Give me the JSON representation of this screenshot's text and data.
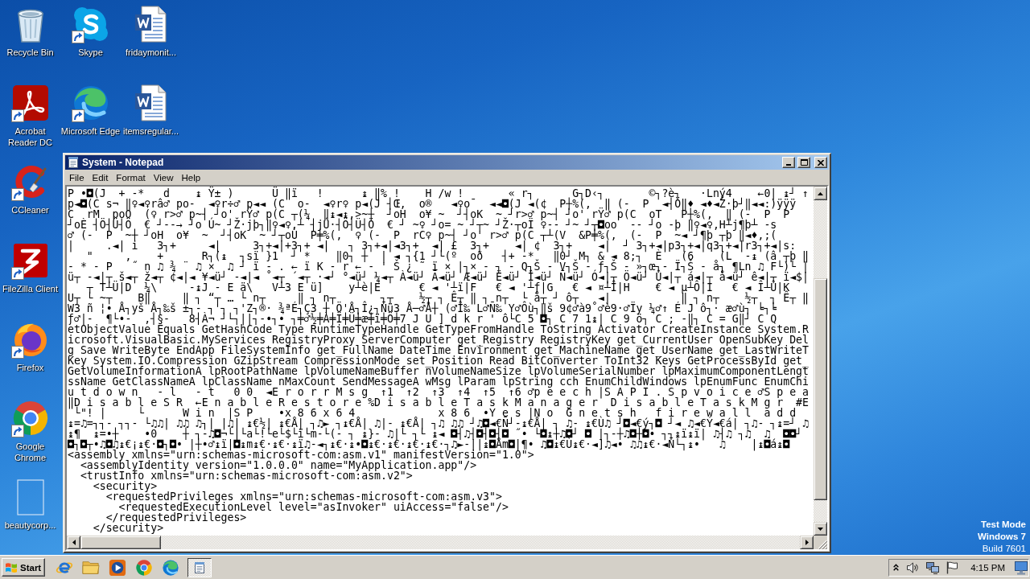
{
  "desktop": {
    "icon_columns": [
      [
        {
          "label": "Recycle Bin",
          "kind": "recyclebin",
          "shortcut": false
        },
        {
          "label": "Acrobat Reader DC",
          "kind": "acrobat",
          "shortcut": true
        },
        {
          "label": "CCleaner",
          "kind": "ccleaner",
          "shortcut": true
        },
        {
          "label": "FileZilla Client",
          "kind": "filezilla",
          "shortcut": true
        },
        {
          "label": "Firefox",
          "kind": "firefox",
          "shortcut": true
        },
        {
          "label": "Google Chrome",
          "kind": "chrome",
          "shortcut": true
        },
        {
          "label": "beautycorp...",
          "kind": "blank",
          "shortcut": false
        }
      ],
      [
        {
          "label": "Skype",
          "kind": "skype",
          "shortcut": true
        },
        {
          "label": "Microsoft Edge",
          "kind": "edge",
          "shortcut": true
        }
      ],
      [
        {
          "label": "fridaymonit...",
          "kind": "word",
          "shortcut": false
        },
        {
          "label": "itemsregular...",
          "kind": "word",
          "shortcut": false
        }
      ]
    ],
    "os_notice": {
      "mode": "Test Mode",
      "edition": "Windows 7",
      "build": "Build 7601"
    }
  },
  "notepad": {
    "title": "System - Notepad",
    "menu": [
      "File",
      "Edit",
      "Format",
      "View",
      "Help"
    ],
    "lines": [
      "P •◘(J  + -*   d    ↨ Ÿ± )      Ü ‖ï   !      ↨ ‖% !    H /w !       « r┐      G┐D‹┐       ©┐?è┐   ·Lný4    ←0| ↨┘ ↑",
      "p◄◘(C s¬ ‖♀◄♀râ♂ po-  ◄♀r÷♂ p◄◄ (C  o-  ◄♀r♀ p◄(J ┤Œ,  o®   ◄♀o¯  ◄◄◘(J ◄(¢  P┼%(,  ‖ (-  P  ◄┤Ö‖♦ ◄♦◄Ž·þ┘‖◄◄:)ÿÿÿ",
      "C  rM  poO  (♀ r>♂ p~┤ ┘o' rŸ♂ p(C ┬(¼  ‖↨◄↨,>~┼  ┘oH  o¥ ~  ┘┤oK  ~ ┘r>♂ p~┤ ┘o' rŸ♂ p(C  oT   P┼%(,  ‖ (-  P  P",
      "┘oÈ ┤Ö┤Ü┤Ö  € ┘--→ ┘o Ú~ ┘Ž·jþ┐‖♀◄♀,┴ ┤jÚ·┤Ö┤Ü┤Ö  € ┘ ~♀ ┘o= ~ ┘┬~ ┘Ž·┬oÏ ♀-- ┘~ ┘┬◘oo  -- ┘o -þ ‖♀◄♀,H┴j¶þ┴ -s",
      "♂ (-  P  ~┼ ┘oH  o¥  ~  ┘┤oK  ~ ┘┬oÙ  P╪%(,  ♀ (-  P  rC♀ p~┤ ┘o' r>♂ p(C ┬┴(V  &P╪%(,  (-  P  ~◄ ┘¶þ ┬þ ‖◄♦,;(",
      "|     .◄| i   3┐+     ◄|     3┐+◄|+3┐+ ◄|   ┐ 3┐+◄|◄3┐+  ◄| £  3┐+    ◄| ¢  3┐+    ◄|  ┘ 3┐+◄|p3┐+◄|q3┐+◄|r3┐+◄|s:",
      "   \"     ,    +      R┐(↨  ┐sï }1  ┘ *    ‖0┐ ┼  | ◄ ┐{1 ┘└(º  oð   ┤+ -*   ‖0┘ M┐ & ◄ 8;┐  È   (6    (L  -↨ (â ┬þ ‖",
      "- * - P   ˝ n ♫ ¾ ¨ ♫ ×  ♫ ┘ ï - . ← ï K - r ← - ' Š ¿ ˜ ï × |┐× - ┐ - Q┐Š - V┐Š - ƒ┐Š - »┐œ┐- Ï┐Š - å┐ ¶Ln ♫ F└)└ |",
      "ü┬ -◄|┬ š◄┬ ž◄┬ ¢◄|◄ ¥◄ü┘ -◄|◄ ˚◄┬ ´◄┬ ·◄┘ °◄ü┘ ¼◄┬ À◄ü┘ Ã◄ü┘ Æ◄ü┘ Ë◄ü┘ Î◄ü┘ Ñ◄ü┘ Ó◄|┬ Ö◄ü┘ Û◄|┬ á◄|┬ å◄ü┘ ê◄|┬ ï◄$|",
      "   ┬ T┴Ü|D  ¼\\     -↨J - E ä\\   V┴3 E ü]    y┴è|E      € ◄ '┴ï|F   € ◄ '┴ƒ|G   € ◄ ¤┴Î|H    € ◄ µ┴Ô|I   € ◄ Î┴Û|K",
      "U┬ └ ~┬    B‖     ‖ ┐ “┬ … └ n┬     ‖ ┐ n┬       ┐┬    ½┬ ┐ Ê┬ ‖ ┐ n┬  └ å┬ ┘ ô┬   ◄|           ‖ ┐ n┬    ½┬  ┐ Ê┬ ‖",
      "W3 ñ ¦• Å┐yš Å┐‰š ±┐- ┐'┐ ┐'Z┐®· ¾ªÉ┐Ç3 ┼ Ö'Å┐Î¿┐Ñü3 Å─♂Å┼ (♂Î‰ L♂Ñ‰ Y♂Ôù┐‖š 9¢♂à9˚♂è9·♂Ïy ¼♂↑ É J ô┐· æ♂ù┐ ╘┐╘",
      "ƒ♂|-  ¶└•-  ,┤§-   8┤À¬ ┘└┐||┐-•┐• ┐╪♂½╪À╪Ï╪Ü╪æ╪ï╪Ö╪7 J U ] d k r ' ô└C 5 ◘┐ C 7 1↨| C 9 ö┐ C ; -‖┐ C = G‖┘ C Q",
      "etObjectValue Equals GetHashCode Type RuntimeTypeHandle GetTypeFromHandle ToString Activator CreateInstance System.R",
      "icrosoft.VisualBasic.MyServices RegistryProxy ServerComputer get_Registry RegistryKey get_CurrentUser OpenSubKey Del",
      "g Save WriteByte EndApp FileSystemInfo get_FullName DateTime Environment get_MachineName get_UserName get_LastWriteT",
      "Key System.IO.Compression GZipStream CompressionMode set_Position Read BitConverter ToInt32 Keys GetProcessById get_",
      "GetVolumeInformationA lpRootPathName lpVolumeNameBuffer nVolumeNameSize lpVolumeSerialNumber lpMaximumComponentLengt",
      "ssName GetClassNameA lpClassName nMaxCount SendMessageA wMsg lParam lpString cch EnumChildWindows lpEnumFunc EnumChi",
      "u t d o w n   - l   - t   0 0  ◄E r o r r M s g  ↑1  ↑2  ↑3  ↑4  ↑5  ↑6 ♂p e e c h |S A P I . S p v o i c e ♂S p e a",
      "‖D i s a b l e S R  ←E n a b l e R e s t o r e %D i s a b l e T a s k M a n a g e r  D i s a b l e T a s k M g r  #E",
      " └\"! |     └      W i n  |S P    •x 8 6 x 6 4             x 8 6  •Y e s |N o  G n e t s h   f i r e w a l l  a d d",
      "↨=♫=┐┐- ┐┐- └♫♫| ♫♫ ♫┐| |♫| ↨€½| ↨€Å| ┐♫► ┐↨€Å| ♫|- ↨€Å| ┐♫ ♫♫ ┘♫◘◄€Ñ┘-↨€Å| ┐ ♫- ↨€Ù♫ ┘◘◄€ý┐◘ ┘◄ ♫◄€Ý◄€á| ┐♫- ┐↨=┘ ♫",
      "↨¶  ↨=•┼    •0    ┼ ┐-♫◘¬└|└a└!└e└$└ï└m-└(- ┐ ↨}- ♫|└ ┐└ ↨◄ ◘┤♫┤◘┤◘┤◘ ˝• └◘↨┼♫◘┘ ◘ |┐-┼♫◘┼◘• ┐┐↨ï↨ï| ♫┤♫ ┐♫  ♫  ◘◘┘",
      "◘┐◘┬•♫◘♫↨€¡↨€·◘┐◘• |┼•♂↨ï|◘↨m↨€·↨€·↨ï♫-◄┐↨€·↨•◘↨€·↨€·↨€·↨€·┐♫►-||↨◘Åm◘|¶• ♫◘↨€Ù↨€·◄]♫◄• ♫♫↨€·◄Ñ└┐↨•   ♫    |↨◘á↨◘",
      "<assembly xmlns=\"urn:schemas-microsoft-com:asm.v1\" manifestVersion=\"1.0\">",
      "  <assemblyIdentity version=\"1.0.0.0\" name=\"MyApplication.app\"/>",
      "  <trustInfo xmlns=\"urn:schemas-microsoft-com:asm.v2\">",
      "    <security>",
      "      <requestedPrivileges xmlns=\"urn:schemas-microsoft-com:asm.v3\">",
      "        <requestedExecutionLevel level=\"asInvoker\" uiAccess=\"false\"/>",
      "      </requestedPrivileges>",
      "    </security>"
    ]
  },
  "taskbar": {
    "start_label": "Start",
    "quick_launch": [
      {
        "kind": "ie"
      },
      {
        "kind": "explorer"
      },
      {
        "kind": "mediaplayer"
      },
      {
        "kind": "chrome"
      },
      {
        "kind": "edge"
      }
    ],
    "tasks": [
      {
        "kind": "notepad",
        "selected": true
      }
    ],
    "clock": "4:15 PM"
  }
}
